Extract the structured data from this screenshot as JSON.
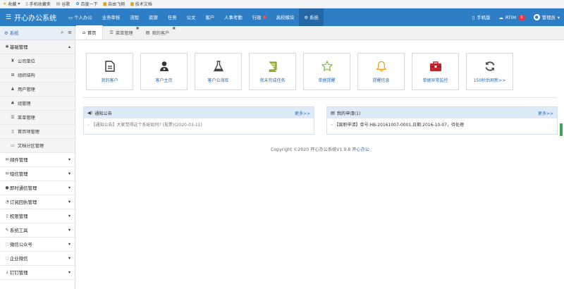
{
  "bookmarks": [
    {
      "icon": "star-icon",
      "label": "收藏"
    },
    {
      "icon": "phone-icon",
      "label": "手机收藏夹"
    },
    {
      "icon": "page-icon",
      "label": "谷歌"
    },
    {
      "icon": "paw-icon",
      "label": "百度一下"
    },
    {
      "icon": "folder-icon",
      "label": "自由飞翔"
    },
    {
      "icon": "folder-icon",
      "label": "技术文档"
    }
  ],
  "topnav": {
    "brand": "开心办公系统",
    "items": [
      {
        "label": "个人办公",
        "icon": "monitor-icon",
        "active": false,
        "dot": false
      },
      {
        "label": "业务审核",
        "active": false,
        "dot": false
      },
      {
        "label": "流程",
        "active": false,
        "dot": false
      },
      {
        "label": "资源",
        "active": false,
        "dot": false
      },
      {
        "label": "任务",
        "active": false,
        "dot": false
      },
      {
        "label": "公文",
        "active": false,
        "dot": false
      },
      {
        "label": "客户",
        "active": false,
        "dot": false
      },
      {
        "label": "人事考勤",
        "active": false,
        "dot": false
      },
      {
        "label": "行政",
        "active": false,
        "dot": true
      },
      {
        "label": "高校模块",
        "active": false,
        "dot": false
      },
      {
        "label": "系统",
        "icon": "gear-icon",
        "active": true,
        "dot": false
      }
    ],
    "right": {
      "mobile_label": "手机版",
      "rtim_label": "RTIM",
      "rtim_badge": "1",
      "user_label": "管理员"
    }
  },
  "sidebar": {
    "title": "系统",
    "groups": [
      {
        "label": "基础管理",
        "icon": "gear-icon",
        "open": true,
        "children": [
          {
            "label": "公司单位",
            "icon": "building-icon"
          },
          {
            "label": "组织结构",
            "icon": "org-icon"
          },
          {
            "label": "用户管理",
            "icon": "user-icon"
          },
          {
            "label": "组管理",
            "icon": "group-icon"
          },
          {
            "label": "菜单管理",
            "icon": "list-icon"
          },
          {
            "label": "首页项管理",
            "icon": "bookmark-icon"
          },
          {
            "label": "文档分区管理",
            "icon": "doc-icon"
          }
        ]
      },
      {
        "label": "邮件管理",
        "icon": "mail-icon"
      },
      {
        "label": "短信管理",
        "icon": "sms-icon"
      },
      {
        "label": "即时通信管理",
        "icon": "chat-icon"
      },
      {
        "label": "订阅回执管理",
        "icon": "rss-icon"
      },
      {
        "label": "权限管理",
        "icon": "bookmark-icon"
      },
      {
        "label": "系统工具",
        "icon": "wrench-icon"
      },
      {
        "label": "微信公众号",
        "icon": "wechat-icon"
      },
      {
        "label": "企业微信",
        "icon": "wechat-icon"
      },
      {
        "label": "钉钉管理",
        "icon": "pin-icon"
      }
    ]
  },
  "tabs": [
    {
      "label": "首页",
      "icon": "home-icon",
      "active": true,
      "closable": false
    },
    {
      "label": "菜单管理",
      "icon": "list-icon",
      "active": false,
      "closable": true
    },
    {
      "label": "我的客户",
      "icon": "doc-icon",
      "active": false,
      "closable": true
    }
  ],
  "shortcuts": [
    {
      "label": "我的客户",
      "icon": "document-icon",
      "color": "#333333"
    },
    {
      "label": "客户主页",
      "icon": "doctor-icon",
      "color": "#333333"
    },
    {
      "label": "客户公海库",
      "icon": "flask-icon",
      "color": "#444444"
    },
    {
      "label": "我未完成任务",
      "icon": "book-icon",
      "color": "#a5b83a"
    },
    {
      "label": "单据提醒",
      "icon": "star-outline-icon",
      "color": "#8cc04b"
    },
    {
      "label": "提醒信息",
      "icon": "bell-icon",
      "color": "#f0a020"
    },
    {
      "label": "单据异常监控",
      "icon": "toolbox-icon",
      "color": "#c0262c"
    },
    {
      "label": "150秒后刷新>>",
      "icon": "refresh-icon",
      "color": "#555555"
    }
  ],
  "panels": {
    "notice": {
      "title": "通知公告",
      "more": "更多>>",
      "item_prefix": "【通知公告】",
      "item_text": "大家觉得这个系统如何? (投票)(2020-03-11)"
    },
    "apply": {
      "title": "我的申请(1)",
      "more": "更多>>",
      "item_text": "【离职申请】单号:HB-20161007-0001,日期:2016-10-07，待处理"
    }
  },
  "footer": {
    "copyright": "Copyright ©2020   开心办公系统V1.9.8",
    "link": "开心办公"
  },
  "colors": {
    "nav": "#2e7ec6",
    "nav_active": "#2367a6",
    "link": "#2e6db0"
  }
}
